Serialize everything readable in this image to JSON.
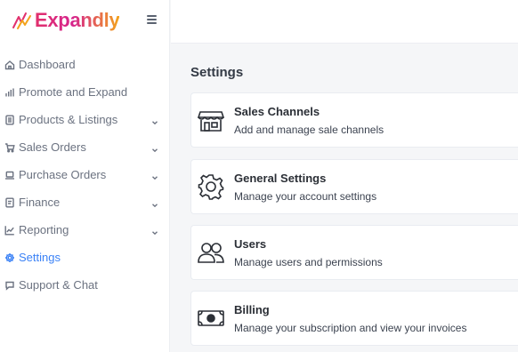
{
  "brand": {
    "name": "Expandly"
  },
  "sidebar": {
    "items": [
      {
        "label": "Dashboard",
        "icon": "home-icon",
        "expandable": false,
        "active": false
      },
      {
        "label": "Promote and Expand",
        "icon": "bar-chart-icon",
        "expandable": false,
        "active": false
      },
      {
        "label": "Products & Listings",
        "icon": "document-icon",
        "expandable": true,
        "active": false
      },
      {
        "label": "Sales Orders",
        "icon": "cart-icon",
        "expandable": true,
        "active": false
      },
      {
        "label": "Purchase Orders",
        "icon": "laptop-icon",
        "expandable": true,
        "active": false
      },
      {
        "label": "Finance",
        "icon": "ledger-icon",
        "expandable": true,
        "active": false
      },
      {
        "label": "Reporting",
        "icon": "line-chart-icon",
        "expandable": true,
        "active": false
      },
      {
        "label": "Settings",
        "icon": "gear-icon",
        "expandable": false,
        "active": true
      },
      {
        "label": "Support & Chat",
        "icon": "chat-icon",
        "expandable": false,
        "active": false
      }
    ]
  },
  "main": {
    "title": "Settings",
    "cards": [
      {
        "title": "Sales Channels",
        "description": "Add and manage sale channels",
        "icon": "storefront-icon"
      },
      {
        "title": "General Settings",
        "description": "Manage your account settings",
        "icon": "gear-icon"
      },
      {
        "title": "Users",
        "description": "Manage users and permissions",
        "icon": "users-icon"
      },
      {
        "title": "Billing",
        "description": "Manage your subscription and view your invoices",
        "icon": "banknote-icon"
      }
    ]
  },
  "colors": {
    "accent": "#3b82f6",
    "brand_pink": "#e1306c",
    "brand_orange": "#f3a31b",
    "text_muted": "#6b7280"
  }
}
